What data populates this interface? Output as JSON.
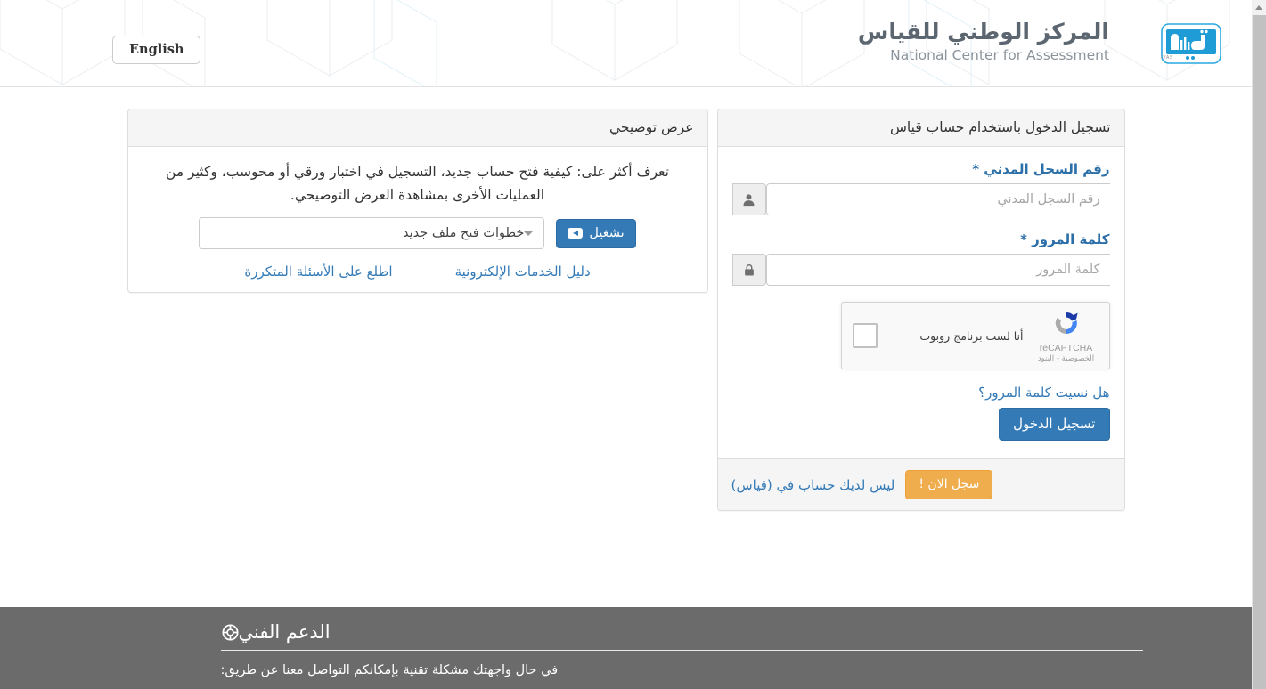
{
  "header": {
    "language_button": "English",
    "brand_ar": "المركز الوطني للقياس",
    "brand_en": "National Center for Assessment",
    "logo_label": "QIYAS"
  },
  "login_panel": {
    "title": "تسجيل الدخول باستخدام حساب قياس",
    "national_id": {
      "label": "رقم السجل المدني *",
      "placeholder": "رقم السجل المدني",
      "value": "",
      "icon": "user-icon"
    },
    "password": {
      "label": "كلمة المرور *",
      "placeholder": "كلمة المرور",
      "value": "",
      "icon": "lock-icon"
    },
    "recaptcha": {
      "checkbox_label": "أنا لست برنامج روبوت",
      "brand": "reCAPTCHA",
      "links": "الخصوصية - البنود",
      "checked": false
    },
    "forgot_password": "هل نسيت كلمة المرور؟",
    "submit_button": "تسجيل الدخول",
    "footer": {
      "signup_text": "ليس لديك حساب في (قياس)",
      "signup_button": "سجل الان !"
    }
  },
  "video_panel": {
    "title": "عرض توضيحي",
    "description": "تعرف أكثر على: كيفية فتح حساب جديد، التسجيل في اختبار ورقي أو محوسب، وكثير من العمليات الأخرى بمشاهدة العرض التوضيحي.",
    "select_value": "خطوات فتح ملف جديد",
    "play_button": "تشغيل",
    "links": [
      "اطلع على الأسئلة المتكررة",
      "دليل الخدمات الإلكترونية"
    ]
  },
  "footer": {
    "support_title": "الدعم الفني",
    "support_icon": "life-ring-icon",
    "support_text": "في حال واجهتك مشكلة تقنية بإمكانكم التواصل معنا عن طريق:"
  },
  "colors": {
    "primary": "#337ab7",
    "warning": "#f0ad4e",
    "link": "#337ab7",
    "footer_bg": "#6b6b6b",
    "panel_heading_bg": "#f5f5f5",
    "brand_gray": "#5b6670",
    "logo_blue": "#1f9bd6"
  }
}
